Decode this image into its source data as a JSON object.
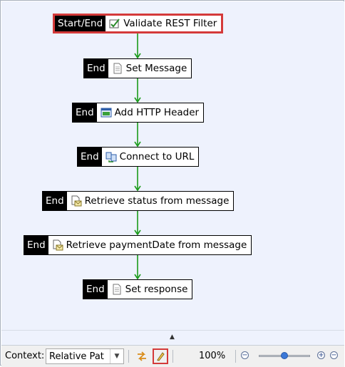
{
  "flow": {
    "nodes": [
      {
        "tag": "Start/End",
        "label": "Validate REST Filter",
        "icon": "validate-filter-icon",
        "selected": true
      },
      {
        "tag": "End",
        "label": "Set Message",
        "icon": "document-icon",
        "selected": false
      },
      {
        "tag": "End",
        "label": "Add HTTP Header",
        "icon": "http-header-icon",
        "selected": false
      },
      {
        "tag": "End",
        "label": "Connect to URL",
        "icon": "connect-url-icon",
        "selected": false
      },
      {
        "tag": "End",
        "label": "Retrieve status from message",
        "icon": "retrieve-message-icon",
        "selected": false
      },
      {
        "tag": "End",
        "label": "Retrieve paymentDate from message",
        "icon": "retrieve-message-icon",
        "selected": false
      },
      {
        "tag": "End",
        "label": "Set response",
        "icon": "document-icon",
        "selected": false
      }
    ]
  },
  "toolbar": {
    "context_label": "Context:",
    "context_value": "Relative Pat",
    "zoom_level": "100%",
    "zoom_fraction": 0.5,
    "zoom_out_symbol": "−",
    "zoom_in_symbol": "+"
  },
  "colors": {
    "canvas_background": "#eef2fd",
    "edge_green": "#1a9a1a",
    "selection_red": "#d43a3a"
  }
}
